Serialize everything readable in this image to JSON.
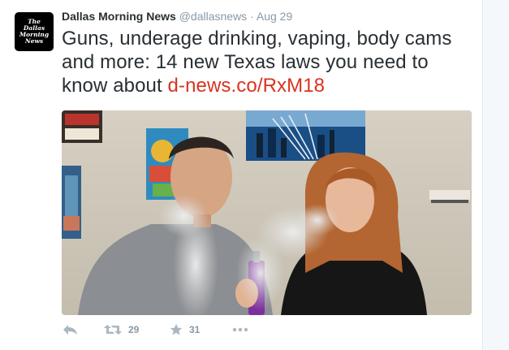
{
  "tweet": {
    "avatar_text_lines": [
      "The",
      "Dallas",
      "Morning",
      "News"
    ],
    "author_name": "Dallas Morning News",
    "handle": "@dallasnews",
    "separator": "·",
    "date": "Aug 29",
    "text": "Guns, underage drinking, vaping, body cams and more: 14 new Texas laws you need to know about ",
    "link": "d-news.co/RxM18"
  },
  "actions": {
    "reply_icon": "reply-icon",
    "retweet_icon": "retweet-icon",
    "retweet_count": "29",
    "favorite_icon": "star-icon",
    "favorite_count": "31",
    "more_icon": "more-dots-icon"
  },
  "colors": {
    "link": "#d9331f",
    "name": "#292f33",
    "meta": "#8899a6",
    "icon": "#aab8c2"
  }
}
